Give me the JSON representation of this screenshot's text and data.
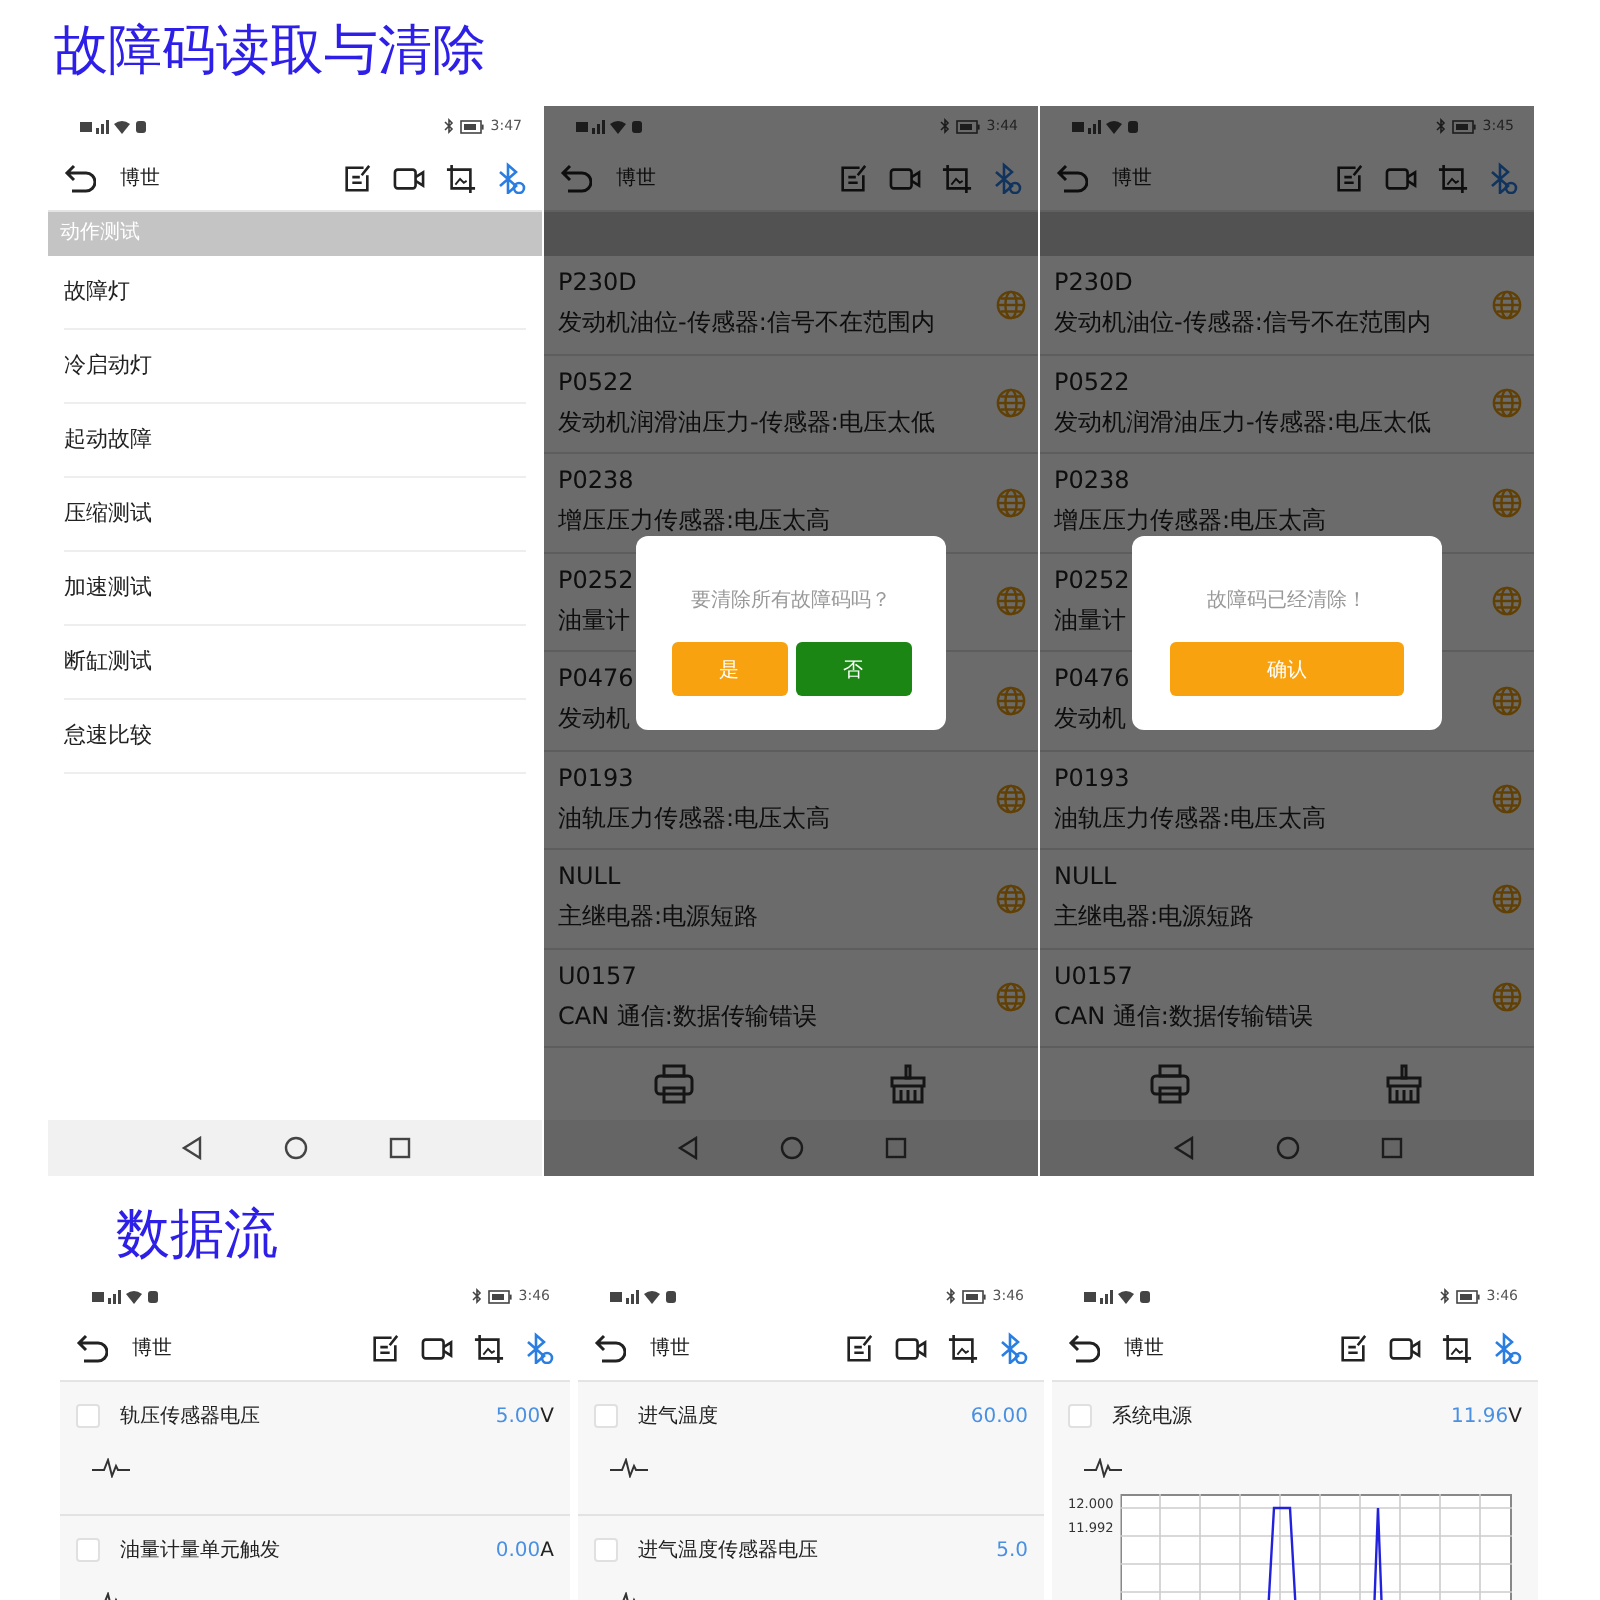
{
  "sections": [
    {
      "title": "故障码读取与清除",
      "phones": [
        {
          "kind": "menu",
          "time": "3:47",
          "app_title": "博世",
          "section_header": "动作测试",
          "items": [
            "故障灯",
            "冷启动灯",
            "起动故障",
            "压缩测试",
            "加速测试",
            "断缸测试",
            "怠速比较"
          ]
        },
        {
          "kind": "codes",
          "time": "3:44",
          "dimmed": true,
          "app_title": "博世",
          "codes": [
            {
              "code": "P230D",
              "description": "发动机油位-传感器:信号不在范围内"
            },
            {
              "code": "P0522",
              "description": "发动机润滑油压力-传感器:电压太低"
            },
            {
              "code": "P0238",
              "description": "增压压力传感器:电压太高"
            },
            {
              "code": "P0252",
              "description": "油量计"
            },
            {
              "code": "P0476",
              "description": "发动机"
            },
            {
              "code": "P0193",
              "description": "油轨压力传感器:电压太高"
            },
            {
              "code": "NULL",
              "description": "主继电器:电源短路"
            },
            {
              "code": "U0157",
              "description": "CAN 通信:数据传输错误"
            }
          ],
          "dialog": {
            "message": "要清除所有故障码吗？",
            "buttons": [
              {
                "label": "是",
                "kind": "yes"
              },
              {
                "label": "否",
                "kind": "no"
              }
            ]
          }
        },
        {
          "kind": "codes",
          "time": "3:45",
          "dimmed": true,
          "app_title": "博世",
          "codes": [
            {
              "code": "P230D",
              "description": "发动机油位-传感器:信号不在范围内"
            },
            {
              "code": "P0522",
              "description": "发动机润滑油压力-传感器:电压太低"
            },
            {
              "code": "P0238",
              "description": "增压压力传感器:电压太高"
            },
            {
              "code": "P0252",
              "description": "油量计"
            },
            {
              "code": "P0476",
              "description": "发动机"
            },
            {
              "code": "P0193",
              "description": "油轨压力传感器:电压太高"
            },
            {
              "code": "NULL",
              "description": "主继电器:电源短路"
            },
            {
              "code": "U0157",
              "description": "CAN 通信:数据传输错误"
            }
          ],
          "dialog": {
            "message": "故障码已经清除！",
            "buttons": [
              {
                "label": "确认",
                "kind": "confirm"
              }
            ]
          }
        }
      ]
    },
    {
      "title": "数据流",
      "phones": [
        {
          "kind": "data",
          "time": "3:46",
          "app_title": "博世",
          "items": [
            {
              "name": "轨压传感器电压",
              "value": "5.00",
              "unit": "V",
              "checked": false
            },
            {
              "name": "油量计量单元触发",
              "value": "0.00",
              "unit": "A",
              "checked": false
            }
          ]
        },
        {
          "kind": "data",
          "time": "3:46",
          "app_title": "博世",
          "items": [
            {
              "name": "进气温度",
              "value": "60.00",
              "checked": false
            },
            {
              "name": "进气温度传感器电压",
              "value": "5.0",
              "checked": false
            }
          ]
        },
        {
          "kind": "data",
          "time": "3:46",
          "app_title": "博世",
          "items": [
            {
              "name": "系统电源",
              "value": "11.96",
              "unit": "V",
              "checked": false,
              "chart_ticks": [
                "12.000",
                "11.992"
              ]
            }
          ]
        }
      ]
    }
  ]
}
